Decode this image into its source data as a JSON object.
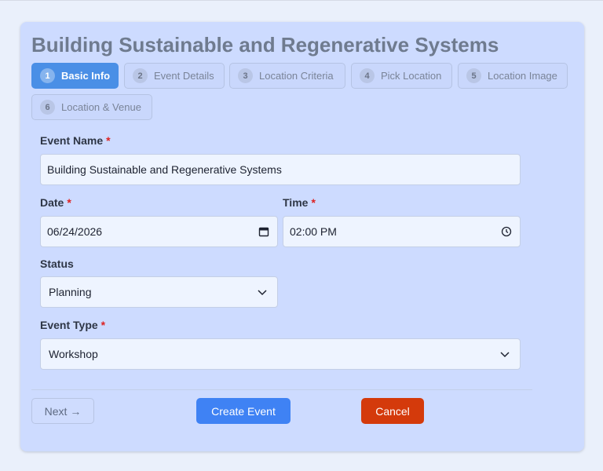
{
  "page": {
    "title": "Building Sustainable and Regenerative Systems"
  },
  "steps": [
    {
      "num": "1",
      "label": "Basic Info",
      "active": true
    },
    {
      "num": "2",
      "label": "Event Details"
    },
    {
      "num": "3",
      "label": "Location Criteria"
    },
    {
      "num": "4",
      "label": "Pick Location"
    },
    {
      "num": "5",
      "label": "Location Image"
    },
    {
      "num": "6",
      "label": "Location & Venue"
    }
  ],
  "form": {
    "event_name": {
      "label": "Event Name",
      "required_mark": "*",
      "value": "Building Sustainable and Regenerative Systems"
    },
    "date": {
      "label": "Date",
      "required_mark": "*",
      "value": "06/24/2026",
      "icon": "calendar-icon"
    },
    "time": {
      "label": "Time",
      "required_mark": "*",
      "value": "02:00 PM",
      "icon": "clock-icon"
    },
    "status": {
      "label": "Status",
      "value": "Planning",
      "icon": "chevron-down-icon"
    },
    "event_type": {
      "label": "Event Type",
      "required_mark": "*",
      "value": "Workshop",
      "icon": "chevron-down-icon"
    }
  },
  "actions": {
    "next": "Next →",
    "create": "Create Event",
    "cancel": "Cancel"
  },
  "colors": {
    "accent": "#3f82f4",
    "active_step": "#4a8fe6",
    "danger": "#d43a0b",
    "card": "#cddbff"
  }
}
